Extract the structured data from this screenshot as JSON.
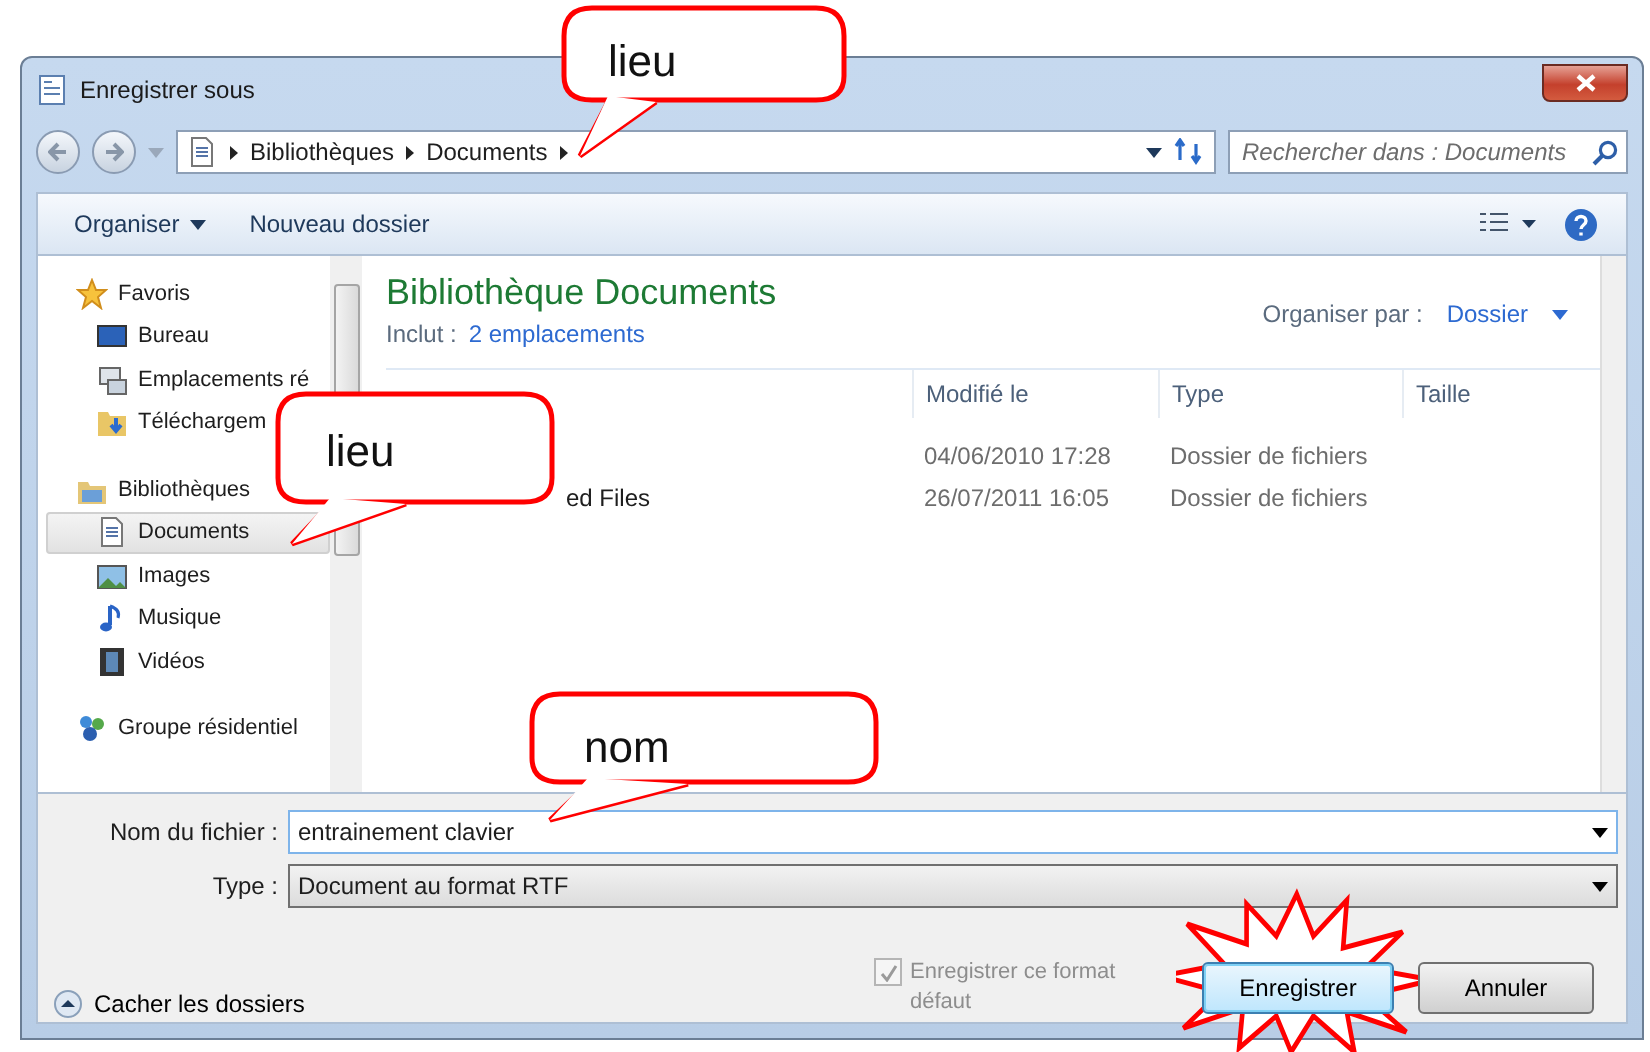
{
  "window": {
    "title": "Enregistrer sous"
  },
  "address_bar": {
    "path": [
      "Bibliothèques",
      "Documents"
    ]
  },
  "search": {
    "placeholder": "Rechercher dans : Documents"
  },
  "toolbar": {
    "items": [
      "Organiser",
      "Nouveau dossier"
    ]
  },
  "sidebar": {
    "groups": [
      {
        "label": "Favoris",
        "kind": "star",
        "children": [
          {
            "label": "Bureau",
            "kind": "desktop",
            "selected": false
          },
          {
            "label": "Emplacements ré",
            "kind": "places",
            "selected": false
          },
          {
            "label": "Téléchargem",
            "kind": "download",
            "selected": false
          }
        ]
      },
      {
        "label": "Bibliothèques",
        "kind": "library",
        "children": [
          {
            "label": "Documents",
            "kind": "document",
            "selected": true
          },
          {
            "label": "Images",
            "kind": "image",
            "selected": false
          },
          {
            "label": "Musique",
            "kind": "music",
            "selected": false
          },
          {
            "label": "Vidéos",
            "kind": "video",
            "selected": false
          }
        ]
      },
      {
        "label": "Groupe résidentiel",
        "kind": "homegroup"
      }
    ]
  },
  "library": {
    "title": "Bibliothèque Documents",
    "includes_label": "Inclut :",
    "includes_link": "2 emplacements",
    "arrange_label": "Organiser par :",
    "arrange_value": "Dossier"
  },
  "table": {
    "columns": [
      "Modifié le",
      "Type",
      "Taille"
    ],
    "rows": [
      {
        "modified": "04/06/2010 17:28",
        "type": "Dossier de fichiers"
      },
      {
        "name": "ed Files",
        "modified": "26/07/2011 16:05",
        "type": "Dossier de fichiers"
      }
    ]
  },
  "form": {
    "filename_label": "Nom du fichier :",
    "filename": "entrainement clavier",
    "type_label": "Type :",
    "type": "Document au format RTF"
  },
  "save_default": {
    "label": "Enregistrer ce format défaut",
    "checked": true,
    "disabled": true
  },
  "hide_folders": "Cacher les dossiers",
  "buttons": [
    {
      "label": "Enregistrer",
      "default": true
    },
    {
      "label": "Annuler",
      "default": false
    }
  ],
  "callouts": [
    {
      "text": "lieu"
    },
    {
      "text": "lieu"
    },
    {
      "text": "nom"
    }
  ]
}
